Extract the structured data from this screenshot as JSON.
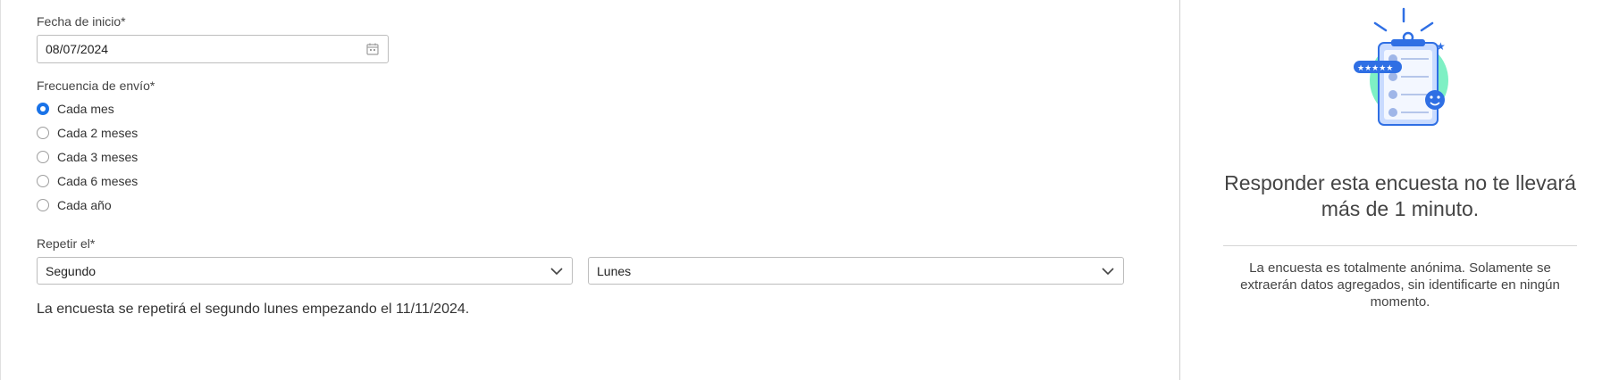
{
  "form": {
    "start_date": {
      "label": "Fecha de inicio*",
      "value": "08/07/2024"
    },
    "frequency": {
      "label": "Frecuencia de envío*",
      "options": [
        {
          "label": "Cada mes",
          "checked": true
        },
        {
          "label": "Cada 2 meses",
          "checked": false
        },
        {
          "label": "Cada 3 meses",
          "checked": false
        },
        {
          "label": "Cada 6 meses",
          "checked": false
        },
        {
          "label": "Cada año",
          "checked": false
        }
      ]
    },
    "repeat": {
      "label": "Repetir el*",
      "ordinal_value": "Segundo",
      "weekday_value": "Lunes"
    },
    "summary": "La encuesta se repetirá el segundo lunes empezando el 11/11/2024."
  },
  "side": {
    "title": "Responder esta encuesta no te llevará más de 1 minuto.",
    "note": "La encuesta es totalmente anónima. Solamente se extraerán datos agregados, sin identificarte en ningún momento."
  },
  "colors": {
    "accent": "#1a73e8",
    "illustration_mint": "#7ef0c4",
    "illustration_blue": "#2f6fe4"
  }
}
